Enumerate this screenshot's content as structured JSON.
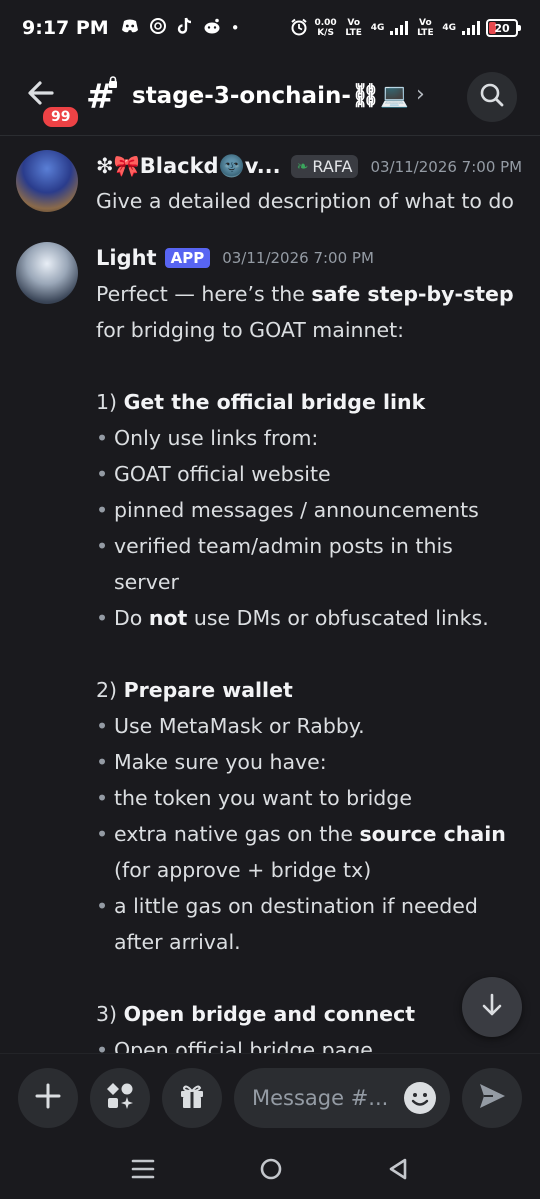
{
  "status_bar": {
    "time": "9:17 PM",
    "notification_icons": [
      "discord-icon",
      "chatgpt-icon",
      "tiktok-icon",
      "reddit-icon",
      "dot-icon"
    ],
    "data_speed_value": "0.00",
    "data_speed_unit": "K/S",
    "sim1": "Vo LTE",
    "net1": "4G",
    "sim2": "Vo LTE",
    "net2": "4G",
    "battery": "20"
  },
  "header": {
    "unread_badge": "99",
    "channel_prefix": "#",
    "channel_name": "stage-3-onchain-⛓💻",
    "chevron": "›"
  },
  "messages": [
    {
      "author": "❇🎀Blackd🌚v...",
      "tag": "RAFA",
      "timestamp": "03/11/2026 7:00 PM",
      "text": "Give a detailed description of what to do"
    },
    {
      "author": "Light",
      "badge": "APP",
      "timestamp": "03/11/2026 7:00 PM",
      "intro_a": "Perfect — here’s the ",
      "intro_b": "safe step-by-step",
      "intro_c": "for bridging to GOAT mainnet:",
      "s1_num": "1) ",
      "s1_title": "Get the official bridge link",
      "s1_b1": "Only use links from:",
      "s1_b2": "GOAT official website",
      "s1_b3": "pinned messages / announcements",
      "s1_b4": "verified team/admin posts in this server",
      "s1_b5_a": "Do ",
      "s1_b5_b": "not",
      "s1_b5_c": " use DMs or obfuscated links.",
      "s2_num": "2) ",
      "s2_title": "Prepare wallet",
      "s2_b1": "Use MetaMask or Rabby.",
      "s2_b2": "Make sure you have:",
      "s2_b3": "the token you want to bridge",
      "s2_b4_a": "extra native gas on the ",
      "s2_b4_b": "source chain",
      "s2_b4_c": " (for approve + bridge tx)",
      "s2_b5": "a little gas on destination if needed after arrival.",
      "s3_num": "3) ",
      "s3_title": "Open bridge and connect",
      "s3_b1": "Open official bridge page"
    }
  ],
  "composer": {
    "placeholder": "Message #..."
  }
}
